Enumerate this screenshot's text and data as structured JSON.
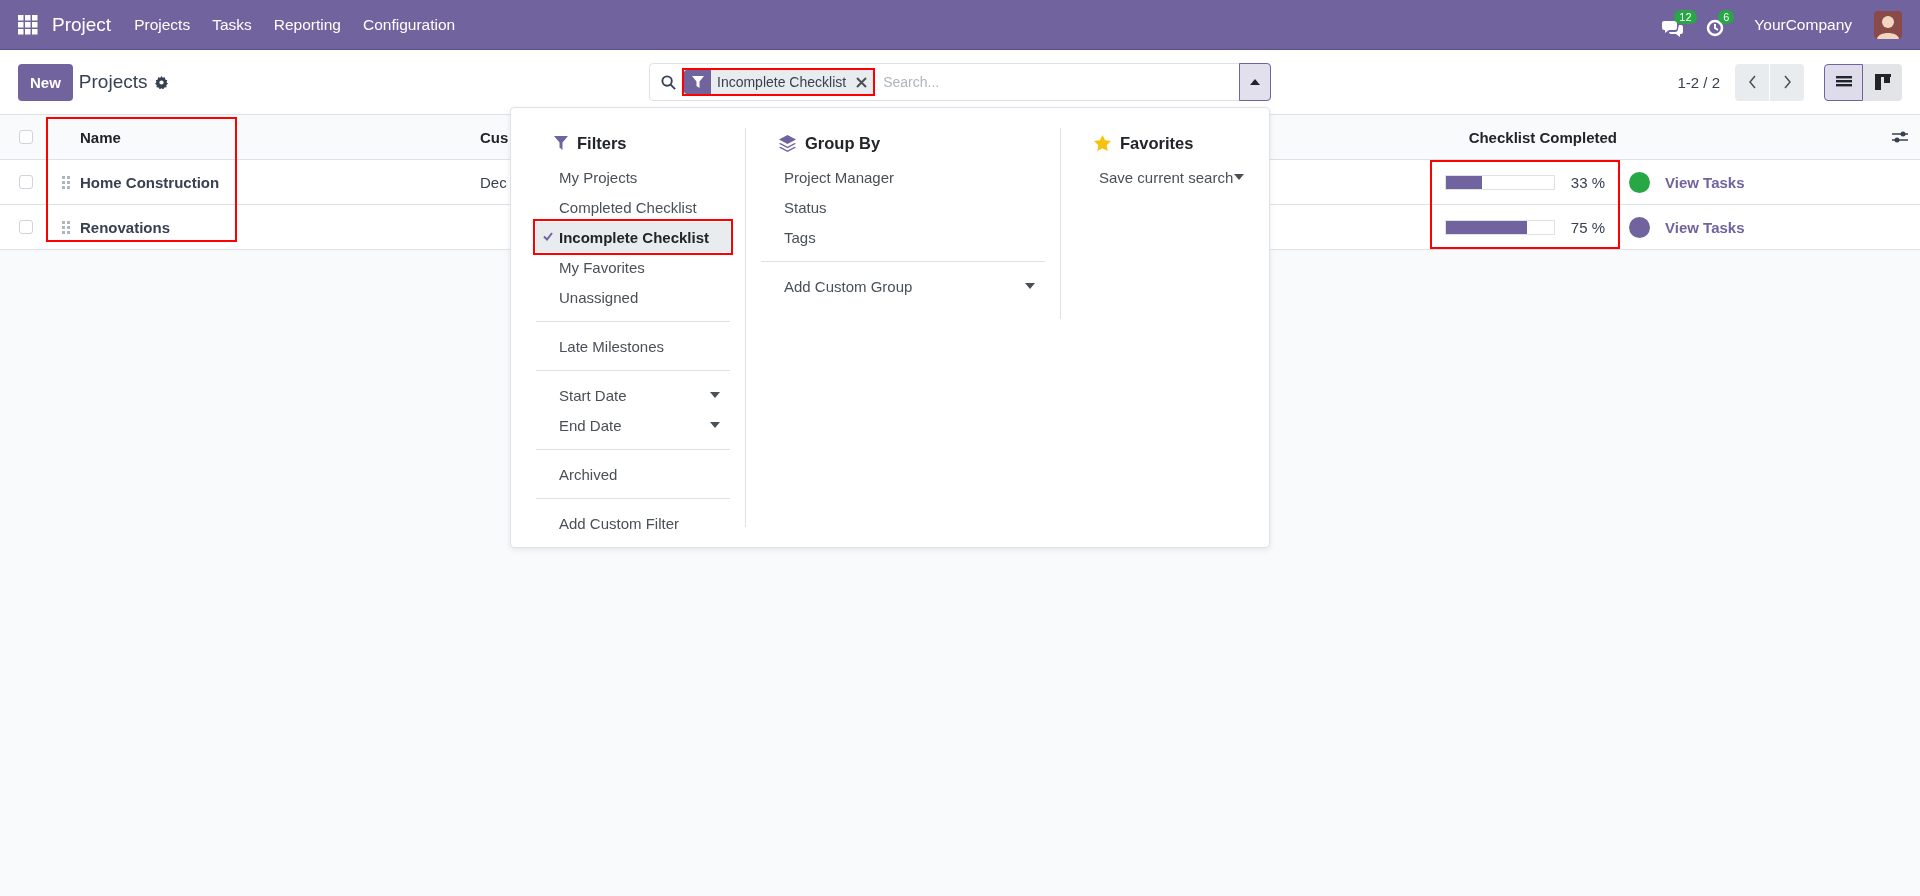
{
  "navbar": {
    "app_name": "Project",
    "menu": [
      "Projects",
      "Tasks",
      "Reporting",
      "Configuration"
    ],
    "messages_count": "12",
    "activities_count": "6",
    "company": "YourCompany"
  },
  "control_panel": {
    "new_button": "New",
    "breadcrumb": "Projects",
    "search": {
      "facets": [
        {
          "label": "Incomplete Checklist",
          "highlighted": true
        }
      ],
      "placeholder": "Search..."
    },
    "pager": "1-2 / 2",
    "views": [
      {
        "kind": "list",
        "selected": true
      },
      {
        "kind": "kanban",
        "selected": false
      }
    ]
  },
  "table": {
    "all_checked": false,
    "name_column_highlighted": true,
    "checklist_highlighted": true,
    "columns": [
      "Name",
      "Cus",
      "Checklist Completed"
    ],
    "rows": [
      {
        "checked": false,
        "name": "Home Construction",
        "column_2": "Dec",
        "level": 0.33,
        "reading": "33 %",
        "color": "#28a745",
        "link": "View Tasks"
      },
      {
        "checked": false,
        "name": "Renovations",
        "level": 0.75,
        "reading": "75 %",
        "color": "#71639e",
        "link": "View Tasks"
      }
    ]
  },
  "search_panel": {
    "filters": {
      "title": "Filters",
      "groups": [
        [
          {
            "label": "My Projects",
            "selected": false,
            "kind": "plain"
          },
          {
            "label": "Completed Checklist",
            "selected": false,
            "kind": "plain"
          },
          {
            "label": "Incomplete Checklist",
            "selected": true,
            "kind": "plain",
            "highlighted": true
          },
          {
            "label": "My Favorites",
            "selected": false,
            "kind": "plain"
          },
          {
            "label": "Unassigned",
            "selected": false,
            "kind": "plain"
          }
        ],
        [
          {
            "label": "Late Milestones",
            "selected": false,
            "kind": "plain"
          }
        ],
        [
          {
            "label": "Start Date",
            "selected": false,
            "kind": "dropdown"
          },
          {
            "label": "End Date",
            "selected": false,
            "kind": "dropdown"
          }
        ],
        [
          {
            "label": "Archived",
            "selected": false,
            "kind": "plain"
          }
        ],
        [
          {
            "label": "Add Custom Filter",
            "selected": false,
            "kind": "plain"
          }
        ]
      ]
    },
    "group_by": {
      "title": "Group By",
      "groups": [
        [
          {
            "label": "Project Manager",
            "selected": false,
            "kind": "plain"
          },
          {
            "label": "Status",
            "selected": false,
            "kind": "plain"
          },
          {
            "label": "Tags",
            "selected": false,
            "kind": "plain"
          }
        ],
        [
          {
            "label": "Add Custom Group",
            "selected": false,
            "kind": "dropdown"
          }
        ]
      ]
    },
    "favorites": {
      "title": "Favorites",
      "groups": [
        [
          {
            "label": "Save current search",
            "selected": false,
            "kind": "dropdown"
          }
        ]
      ]
    }
  }
}
